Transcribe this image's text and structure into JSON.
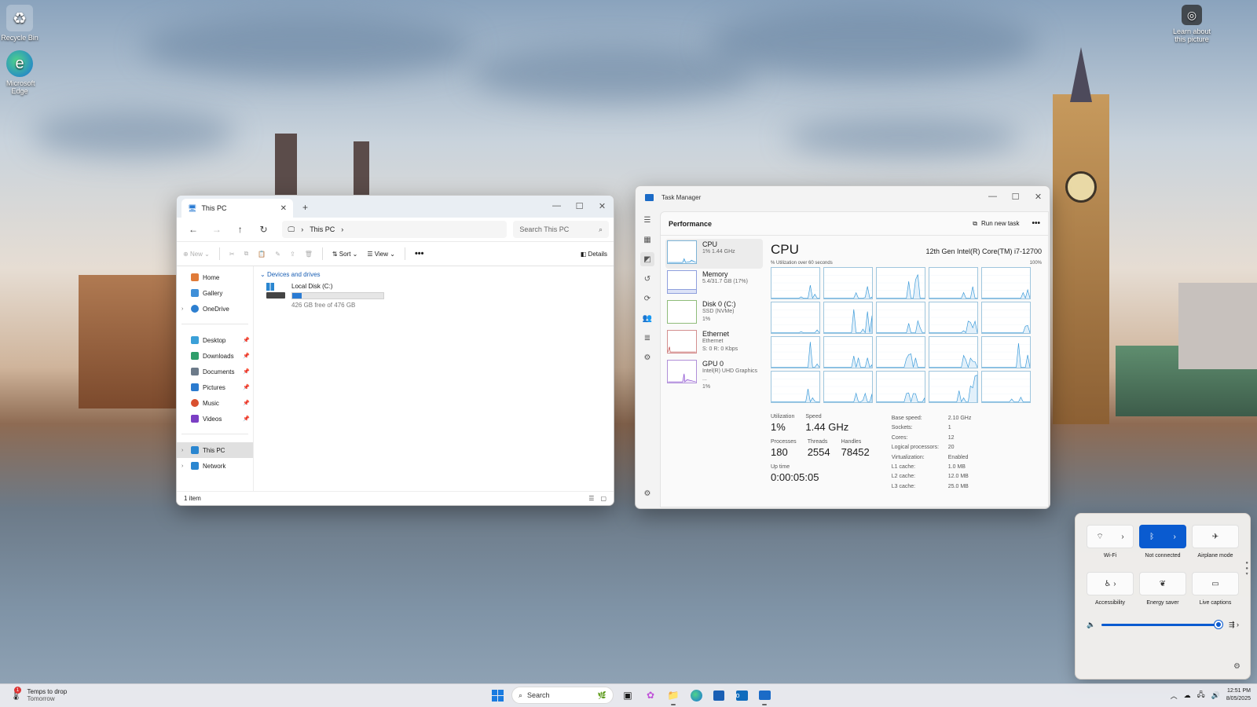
{
  "desktop": {
    "icons": [
      {
        "label": "Recycle Bin"
      },
      {
        "label": "Microsoft Edge"
      },
      {
        "label": "Learn about this picture"
      }
    ]
  },
  "explorer": {
    "tab_title": "This PC",
    "breadcrumb": "This PC",
    "search_placeholder": "Search This PC",
    "toolbar": {
      "new": "New",
      "sort": "Sort",
      "view": "View",
      "details": "Details"
    },
    "nav": [
      {
        "label": "Home",
        "icon": "home-icon",
        "pinned": false
      },
      {
        "label": "Gallery",
        "icon": "gallery-icon",
        "pinned": false
      },
      {
        "label": "OneDrive",
        "icon": "cloud-icon",
        "pinned": false
      },
      {
        "label": "Desktop",
        "icon": "desktop-icon",
        "pinned": true
      },
      {
        "label": "Downloads",
        "icon": "download-icon",
        "pinned": true
      },
      {
        "label": "Documents",
        "icon": "document-icon",
        "pinned": true
      },
      {
        "label": "Pictures",
        "icon": "pictures-icon",
        "pinned": true
      },
      {
        "label": "Music",
        "icon": "music-icon",
        "pinned": true
      },
      {
        "label": "Videos",
        "icon": "videos-icon",
        "pinned": true
      },
      {
        "label": "This PC",
        "icon": "pc-icon",
        "pinned": false
      },
      {
        "label": "Network",
        "icon": "network-icon",
        "pinned": false
      }
    ],
    "group_header": "Devices and drives",
    "drive": {
      "name": "Local Disk (C:)",
      "free": "426 GB free of 476 GB",
      "used_fraction": 0.105
    },
    "status": "1 item"
  },
  "taskmgr": {
    "title": "Task Manager",
    "page": "Performance",
    "run_new_task": "Run new task",
    "list": [
      {
        "name": "CPU",
        "sub1": "1% 1.44 GHz",
        "sub2": ""
      },
      {
        "name": "Memory",
        "sub1": "5.4/31.7 GB (17%)",
        "sub2": ""
      },
      {
        "name": "Disk 0 (C:)",
        "sub1": "SSD (NVMe)",
        "sub2": "1%"
      },
      {
        "name": "Ethernet",
        "sub1": "Ethernet",
        "sub2": "S: 0 R: 0 Kbps"
      },
      {
        "name": "GPU 0",
        "sub1": "Intel(R) UHD Graphics ...",
        "sub2": "1%"
      }
    ],
    "detail": {
      "heading": "CPU",
      "model": "12th Gen Intel(R) Core(TM) i7-12700",
      "util_label": "% Utilization over 60 seconds",
      "util_max": "100%",
      "stats": {
        "utilization_label": "Utilization",
        "utilization": "1%",
        "speed_label": "Speed",
        "speed": "1.44 GHz",
        "processes_label": "Processes",
        "processes": "180",
        "threads_label": "Threads",
        "threads": "2554",
        "handles_label": "Handles",
        "handles": "78452",
        "uptime_label": "Up time",
        "uptime": "0:00:05:05"
      },
      "specs": [
        {
          "k": "Base speed:",
          "v": "2.10 GHz"
        },
        {
          "k": "Sockets:",
          "v": "1"
        },
        {
          "k": "Cores:",
          "v": "12"
        },
        {
          "k": "Logical processors:",
          "v": "20"
        },
        {
          "k": "Virtualization:",
          "v": "Enabled"
        },
        {
          "k": "L1 cache:",
          "v": "1.0 MB"
        },
        {
          "k": "L2 cache:",
          "v": "12.0 MB"
        },
        {
          "k": "L3 cache:",
          "v": "25.0 MB"
        }
      ]
    }
  },
  "quick_settings": {
    "tiles": [
      {
        "label": "Wi-Fi",
        "icon": "wifi-icon",
        "on": false
      },
      {
        "label": "Not connected",
        "icon": "bluetooth-icon",
        "on": true
      },
      {
        "label": "Airplane mode",
        "icon": "airplane-icon",
        "on": false
      },
      {
        "label": "Accessibility",
        "icon": "accessibility-icon",
        "on": false
      },
      {
        "label": "Energy saver",
        "icon": "energy-saver-icon",
        "on": false
      },
      {
        "label": "Live captions",
        "icon": "captions-icon",
        "on": false
      }
    ],
    "volume_fraction": 0.97
  },
  "taskbar": {
    "weather_title": "Temps to drop",
    "weather_sub": "Tomorrow",
    "weather_badge": "1",
    "search_label": "Search",
    "time": "12:51 PM",
    "date": "8/05/2025"
  },
  "colors": {
    "accent": "#0a5bd0",
    "cpu_line": "#3a9ad9"
  }
}
